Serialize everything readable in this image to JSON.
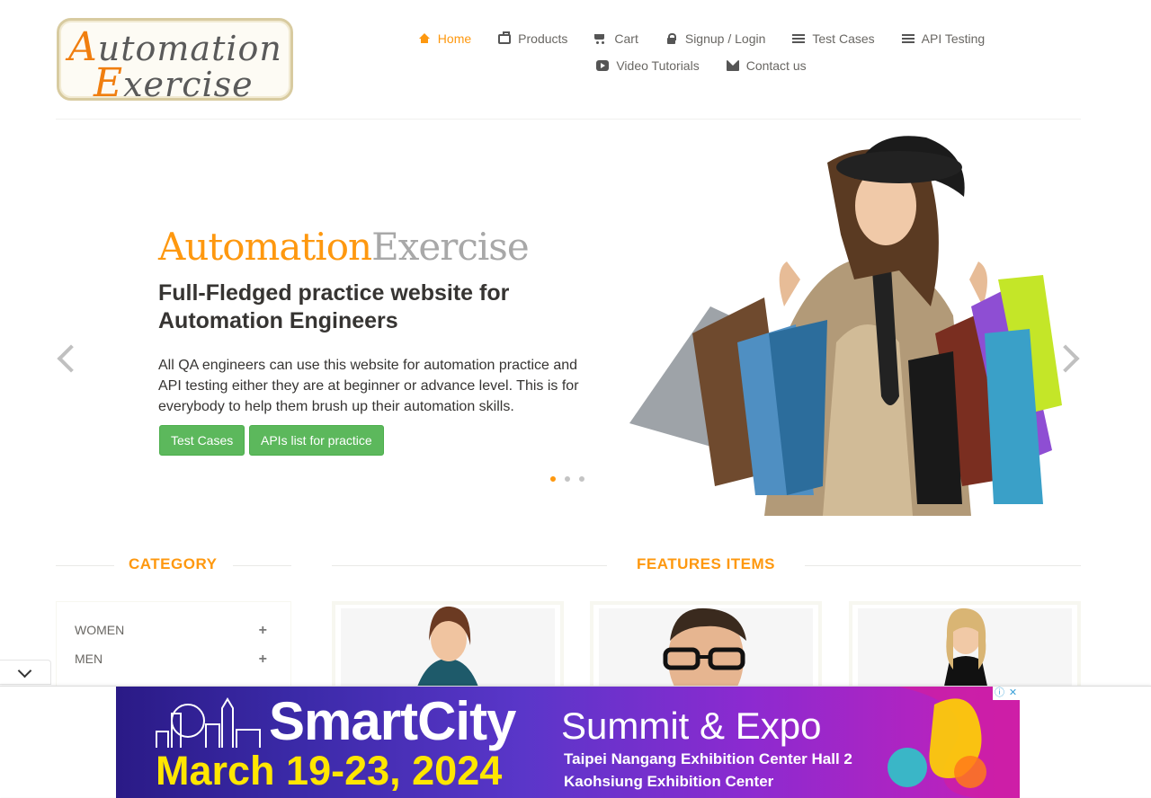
{
  "logo": {
    "line1_cap": "A",
    "line1_rest": "utomation",
    "line2_cap": "E",
    "line2_rest": "xercise"
  },
  "nav": {
    "items": [
      {
        "label": "Home",
        "icon": "home-icon"
      },
      {
        "label": "Products",
        "icon": "product-box-icon"
      },
      {
        "label": "Cart",
        "icon": "cart-icon"
      },
      {
        "label": "Signup / Login",
        "icon": "lock-icon"
      },
      {
        "label": "Test Cases",
        "icon": "list-icon"
      },
      {
        "label": "API Testing",
        "icon": "list-icon"
      },
      {
        "label": "Video Tutorials",
        "icon": "youtube-play-icon"
      },
      {
        "label": "Contact us",
        "icon": "envelope-icon"
      }
    ]
  },
  "slider": {
    "title_part1": "Automation",
    "title_part2": "Exercise",
    "heading": "Full-Fledged practice website for Automation Engineers",
    "text": "All QA engineers can use this website for automation practice and API testing either they are at beginner or advance level. This is for everybody to help them brush up their automation skills.",
    "button1": "Test Cases",
    "button2": "APIs list for practice",
    "active_slide": 1,
    "slide_count": 3
  },
  "category": {
    "title": "CATEGORY",
    "items": [
      {
        "label": "WOMEN"
      },
      {
        "label": "MEN"
      }
    ]
  },
  "features": {
    "title": "FEATURES ITEMS"
  },
  "ad": {
    "title_bold": "SmartCity",
    "title_rest": "Summit & Expo",
    "date": "March 19-23, 2024",
    "venue1": "Taipei Nangang Exhibition Center Hall 2",
    "venue2": "Kaohsiung Exhibition Center",
    "info": "ⓘ",
    "close": "✕"
  },
  "colors": {
    "accent": "#fe980f",
    "button_green": "#5cb85c",
    "text": "#696763"
  }
}
